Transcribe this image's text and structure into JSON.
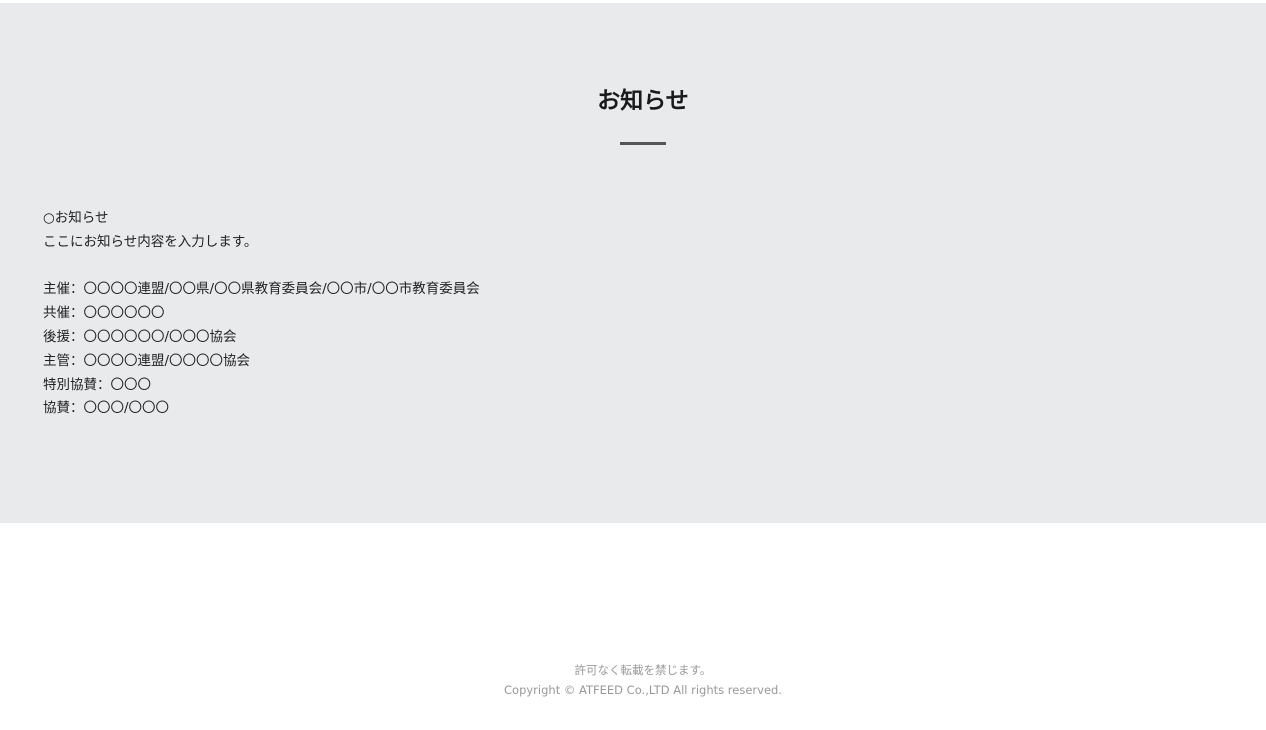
{
  "notice": {
    "title": "お知らせ",
    "lines": [
      "○お知らせ",
      "ここにお知らせ内容を入力します。",
      "",
      "主催：〇〇〇〇連盟/〇〇県/〇〇県教育委員会/〇〇市/〇〇市教育委員会",
      "共催：〇〇〇〇〇〇",
      "後援：〇〇〇〇〇〇/〇〇〇協会",
      "主管：〇〇〇〇連盟/〇〇〇〇協会",
      "特別協賛：〇〇〇",
      "協賛：〇〇〇/〇〇〇"
    ]
  },
  "footer": {
    "notice": "許可なく転載を禁じます。",
    "copyright": "Copyright © ATFEED Co.,LTD All rights reserved."
  },
  "colors": {
    "section_background": "#e9eaec",
    "divider": "#555555",
    "footer_text": "#999999"
  }
}
